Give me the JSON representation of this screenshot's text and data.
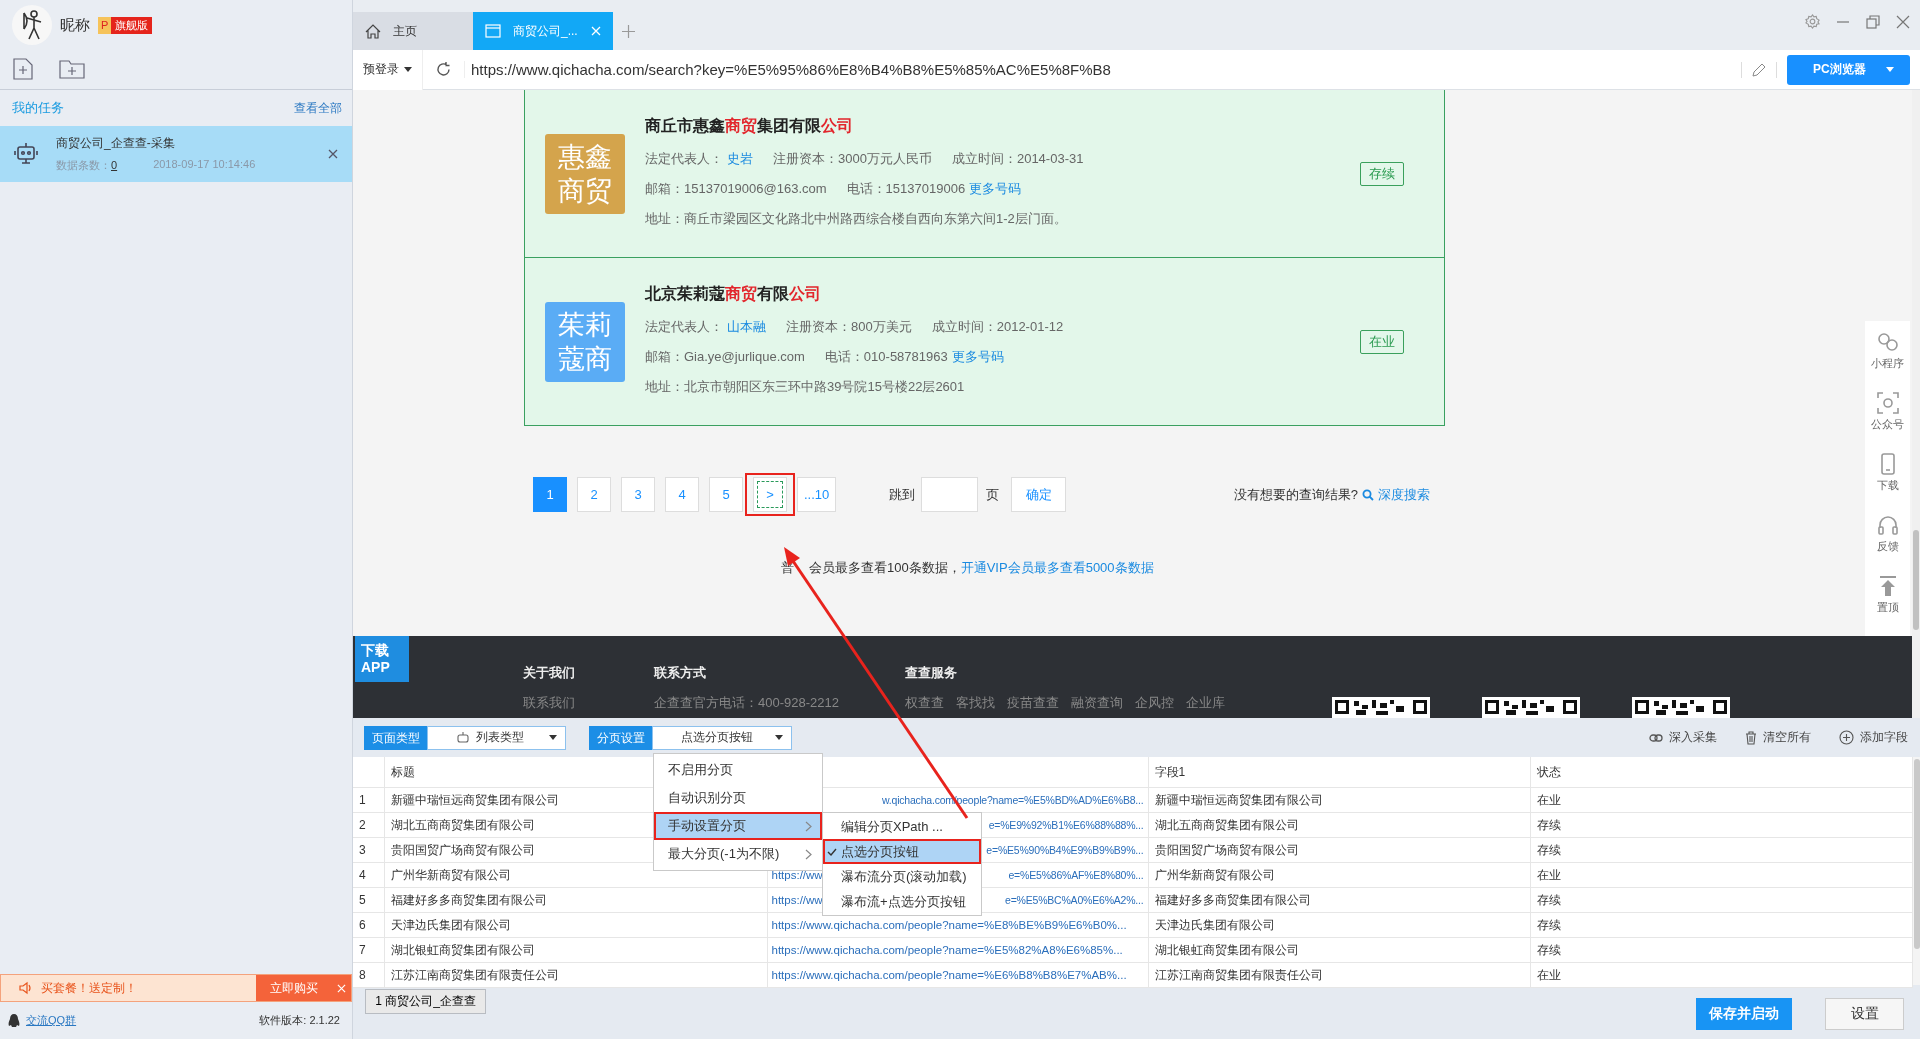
{
  "sidebar": {
    "nickname": "昵称",
    "badge_letter": "P",
    "edition": "旗舰版",
    "section_title": "我的任务",
    "view_all": "查看全部",
    "tasks": [
      {
        "name": "商贸公司_企查查-采集",
        "count_label": "数据条数：",
        "count": "0",
        "time": "2018-09-17 10:14:46",
        "selected": true
      }
    ],
    "promo": {
      "text": "买套餐！送定制！",
      "button": "立即购买"
    },
    "qq_group": "交流QQ群",
    "version": "软件版本: 2.1.22"
  },
  "tabs": [
    {
      "kind": "home",
      "label": "主页",
      "selected": false
    },
    {
      "kind": "page",
      "label": "商贸公司_...",
      "selected": true
    }
  ],
  "address_bar": {
    "login_menu": "预登录",
    "url": "https://www.qichacha.com/search?key=%E5%95%86%E8%B4%B8%E5%85%AC%E5%8F%B8",
    "browser_button": "PC浏览器"
  },
  "web_page": {
    "companies": [
      {
        "logo": "惠鑫商贸",
        "color": "#d4a44c",
        "name_parts": [
          {
            "text": "商丘市惠鑫",
            "hit": false
          },
          {
            "text": "商贸",
            "hit": true
          },
          {
            "text": "集团有限",
            "hit": false
          },
          {
            "text": "公司",
            "hit": true
          }
        ],
        "legal_rep_label": "法定代表人：",
        "legal_rep": "史岩",
        "capital": "注册资本：3000万元人民币",
        "founded": "成立时间：2014-03-31",
        "email": "邮箱：15137019006@163.com",
        "phone": "电话：15137019006",
        "more_phones": "更多号码",
        "address": "地址：商丘市梁园区文化路北中州路西综合楼自西向东第六间1-2层门面。",
        "status": "存续"
      },
      {
        "logo": "茱莉蔻商",
        "color": "#5aacf5",
        "name_parts": [
          {
            "text": "北京茱莉蔻",
            "hit": false
          },
          {
            "text": "商贸",
            "hit": true
          },
          {
            "text": "有限",
            "hit": false
          },
          {
            "text": "公司",
            "hit": true
          }
        ],
        "legal_rep_label": "法定代表人：",
        "legal_rep": "山本融",
        "capital": "注册资本：800万美元",
        "founded": "成立时间：2012-01-12",
        "email": "邮箱：Gia.ye@jurlique.com",
        "phone": "电话：010-58781963",
        "more_phones": "更多号码",
        "address": "地址：北京市朝阳区东三环中路39号院15号楼22层2601",
        "status": "在业"
      }
    ],
    "pagination": {
      "pages": [
        {
          "label": "1",
          "selected": true
        },
        {
          "label": "2",
          "selected": false
        },
        {
          "label": "3",
          "selected": false
        },
        {
          "label": "4",
          "selected": false
        },
        {
          "label": "5",
          "selected": false
        }
      ],
      "next": {
        "label": ">",
        "annotated": true
      },
      "last": "...10",
      "jump_label": "跳到",
      "jump_unit": "页",
      "confirm": "确定",
      "no_result": "没有想要的查询结果?",
      "deep_search": "深度搜索"
    },
    "member_notice": {
      "parts": [
        "普",
        "会员最多查看100条数据，"
      ],
      "link": "开通VIP会员最多查看5000条数据"
    },
    "footer": {
      "app_badge": [
        "下载",
        "APP"
      ],
      "columns": [
        {
          "title": "关于我们",
          "links": [
            "联系我们"
          ]
        },
        {
          "title": "联系方式",
          "links": [
            "企查查官方电话：400-928-2212"
          ]
        },
        {
          "title": "查查服务",
          "links": [
            "权查查",
            "客找找",
            "疫苗查查",
            "融资查询",
            "企风控",
            "企业库"
          ]
        }
      ]
    },
    "side_tools": [
      {
        "kind": "link",
        "label": "小程序"
      },
      {
        "kind": "scan",
        "label": "公众号"
      },
      {
        "kind": "phone",
        "label": "下载"
      },
      {
        "kind": "headset",
        "label": "反馈"
      },
      {
        "kind": "top",
        "label": "置顶"
      }
    ]
  },
  "collector": {
    "page_type": {
      "label": "页面类型",
      "value": "列表类型"
    },
    "paging": {
      "label": "分页设置",
      "value": "点选分页按钮"
    },
    "actions": [
      {
        "kind": "deep",
        "label": "深入采集"
      },
      {
        "kind": "clear",
        "label": "清空所有"
      },
      {
        "kind": "add",
        "label": "添加字段"
      }
    ],
    "paging_menu": {
      "items": [
        {
          "label": "不启用分页",
          "selected": false,
          "submenu": false,
          "annotated": false
        },
        {
          "label": "自动识别分页",
          "selected": false,
          "submenu": false,
          "annotated": false
        },
        {
          "label": "手动设置分页",
          "selected": true,
          "submenu": true,
          "annotated": true
        },
        {
          "label": "最大分页(-1为不限)",
          "selected": false,
          "submenu": true,
          "annotated": false
        }
      ],
      "submenu": [
        {
          "label": "编辑分页XPath ...",
          "checked": false,
          "annotated": false
        },
        {
          "label": "点选分页按钮",
          "checked": true,
          "annotated": true
        },
        {
          "label": "瀑布流分页(滚动加载)",
          "checked": false,
          "annotated": false
        },
        {
          "label": "瀑布流+点选分页按钮",
          "checked": false,
          "annotated": false
        }
      ]
    },
    "table": {
      "header": {
        "title": "标题",
        "field_1": "字段1",
        "status": "状态"
      },
      "rows": [
        {
          "index": "1",
          "title": "新疆中瑞恒远商贸集团有限公司",
          "url_end": "w.qichacha.com/people?name=%E5%BD%AD%E6%B8...",
          "field_1": "新疆中瑞恒远商贸集团有限公司",
          "status": "在业"
        },
        {
          "index": "2",
          "title": "湖北五商商贸集团有限公司",
          "url_end": "e=%E9%92%B1%E6%88%88%...",
          "field_1": "湖北五商商贸集团有限公司",
          "status": "存续"
        },
        {
          "index": "3",
          "title": "贵阳国贸广场商贸有限公司",
          "url_end": "e=%E5%90%B4%E9%B9%B9%...",
          "field_1": "贵阳国贸广场商贸有限公司",
          "status": "存续"
        },
        {
          "index": "4",
          "title": "广州华新商贸有限公司",
          "url": "https://ww",
          "url_end": "e=%E5%86%AF%E8%80%...",
          "field_1": "广州华新商贸有限公司",
          "status": "在业"
        },
        {
          "index": "5",
          "title": "福建好多多商贸集团有限公司",
          "url": "https://ww",
          "url_end": "e=%E5%BC%A0%E6%A2%...",
          "field_1": "福建好多多商贸集团有限公司",
          "status": "存续"
        },
        {
          "index": "6",
          "title": "天津边氏集团有限公司",
          "url": "https://www.qichacha.com/people?name=%E8%BE%B9%E6%B0%...",
          "field_1": "天津边氏集团有限公司",
          "status": "存续"
        },
        {
          "index": "7",
          "title": "湖北银虹商贸集团有限公司",
          "url": "https://www.qichacha.com/people?name=%E5%82%A8%E6%85%...",
          "field_1": "湖北银虹商贸集团有限公司",
          "status": "存续"
        },
        {
          "index": "8",
          "title": "江苏江南商贸集团有限责任公司",
          "url": "https://www.qichacha.com/people?name=%E6%B8%B8%E7%AB%...",
          "field_1": "江苏江南商贸集团有限责任公司",
          "status": "在业"
        }
      ]
    },
    "sheets": [
      {
        "label": "1 商贸公司_企查查",
        "selected": true
      }
    ],
    "save_button": "保存并启动",
    "settings_button": "设置"
  }
}
